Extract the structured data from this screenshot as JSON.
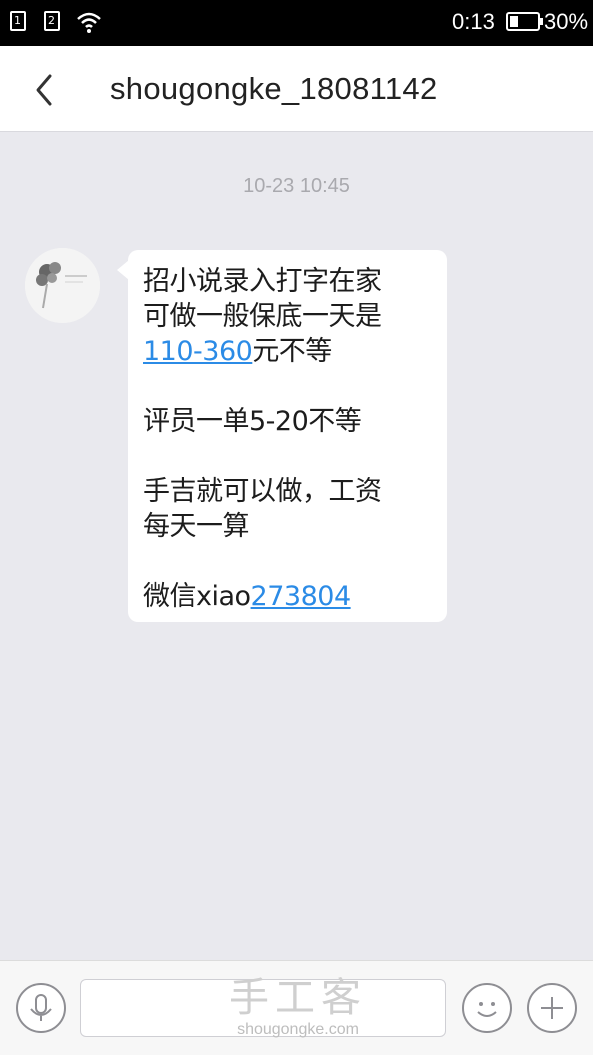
{
  "status_bar": {
    "sim1": "1",
    "sim2": "2",
    "time": "0:13",
    "battery_percent": "30%",
    "battery_level": 0.3
  },
  "header": {
    "title": "shougongke_18081142",
    "back_icon": "chevron-left-icon"
  },
  "chat": {
    "timestamp": "10-23 10:45",
    "message": {
      "line1": "招小说录入打字在家",
      "line2": "可做一般保底一天是",
      "line3_link": "110-360",
      "line3_rest": "元不等",
      "line4": "评员一单5-20不等",
      "line5": "手吉就可以做，工资",
      "line6": "每天一算",
      "line7_prefix": "微信xiao",
      "line7_link": "273804"
    }
  },
  "input_bar": {
    "voice_icon": "microphone-icon",
    "emoji_icon": "smiley-icon",
    "plus_icon": "plus-icon"
  },
  "watermark": {
    "title": "手工客",
    "url": "shougongke.com"
  },
  "colors": {
    "link": "#2b8be6",
    "background": "#e9e9ee",
    "status_bar": "#000000"
  }
}
